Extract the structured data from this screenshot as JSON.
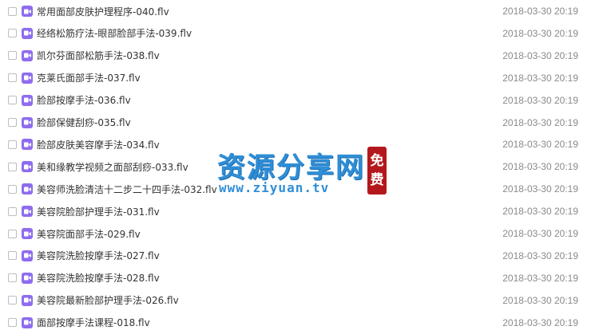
{
  "files": [
    {
      "name": "常用面部皮肤护理程序-040.flv",
      "date": "2018-03-30 20:19",
      "icon": "video-file-icon"
    },
    {
      "name": "经络松筋疗法-眼部脸部手法-039.flv",
      "date": "2018-03-30 20:19",
      "icon": "video-file-icon"
    },
    {
      "name": "凯尔芬面部松筋手法-038.flv",
      "date": "2018-03-30 20:19",
      "icon": "video-file-icon"
    },
    {
      "name": "克莱氏面部手法-037.flv",
      "date": "2018-03-30 20:19",
      "icon": "video-file-icon"
    },
    {
      "name": "脸部按摩手法-036.flv",
      "date": "2018-03-30 20:19",
      "icon": "video-file-icon"
    },
    {
      "name": "脸部保健刮痧-035.flv",
      "date": "2018-03-30 20:19",
      "icon": "video-file-icon"
    },
    {
      "name": "脸部皮肤美容摩手法-034.flv",
      "date": "2018-03-30 20:19",
      "icon": "video-file-icon"
    },
    {
      "name": "美和缘教学视频之面部刮痧-033.flv",
      "date": "2018-03-30 20:19",
      "icon": "video-file-icon"
    },
    {
      "name": "美容师洗脸清洁十二步二十四手法-032.flv",
      "date": "2018-03-30 20:19",
      "icon": "video-file-icon"
    },
    {
      "name": "美容院脸部护理手法-031.flv",
      "date": "2018-03-30 20:19",
      "icon": "video-file-icon"
    },
    {
      "name": "美容院面部手法-029.flv",
      "date": "2018-03-30 20:19",
      "icon": "video-file-icon"
    },
    {
      "name": "美容院洗脸按摩手法-027.flv",
      "date": "2018-03-30 20:19",
      "icon": "video-file-icon"
    },
    {
      "name": "美容院洗脸按摩手法-028.flv",
      "date": "2018-03-30 20:19",
      "icon": "video-file-icon"
    },
    {
      "name": "美容院最新脸部护理手法-026.flv",
      "date": "2018-03-30 20:19",
      "icon": "video-file-icon"
    },
    {
      "name": "面部按摩手法课程-018.flv",
      "date": "2018-03-30 20:19",
      "icon": "video-file-icon"
    }
  ],
  "watermark": {
    "title": "资源分享网",
    "url": "www.ziyuan.tv",
    "seal_1": "免",
    "seal_2": "费"
  },
  "colors": {
    "icon": "#8e6cf0",
    "watermark": "#2f8ed6",
    "seal": "#b3191c"
  }
}
